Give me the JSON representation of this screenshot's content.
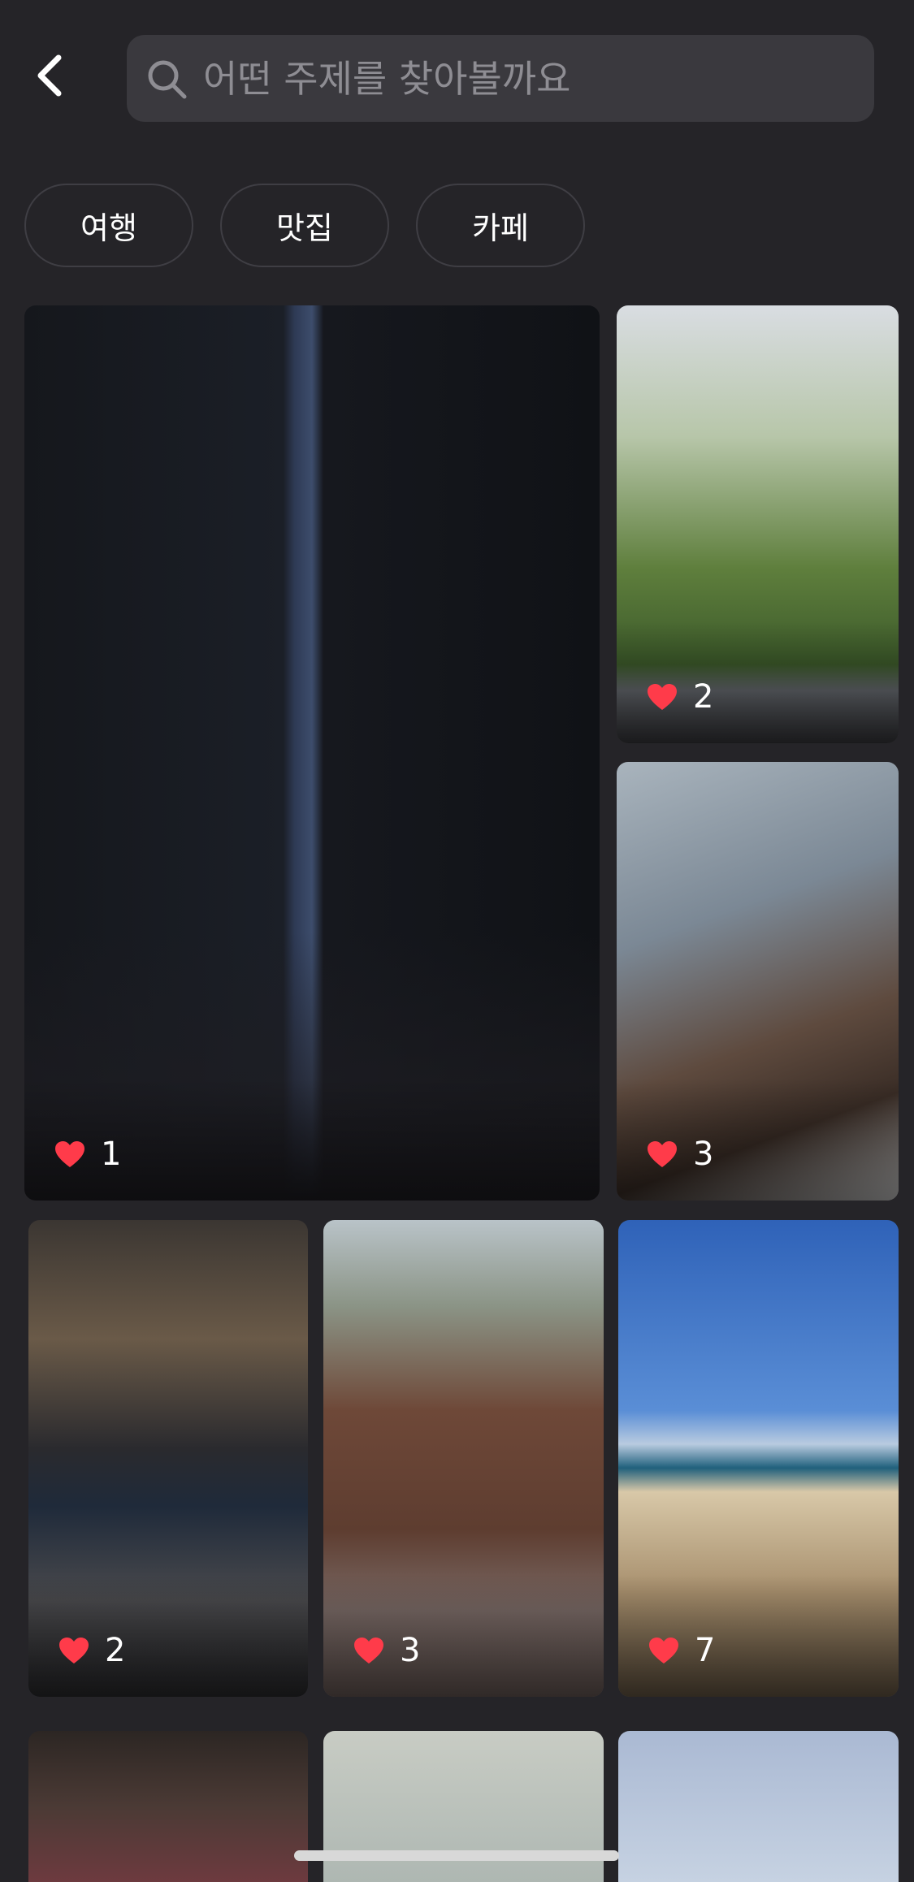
{
  "header": {
    "back_icon": "chevron-left-icon",
    "search": {
      "placeholder": "어떤 주제를 찾아볼까요",
      "value": "",
      "icon": "search-icon"
    }
  },
  "chips": [
    {
      "label": "여행"
    },
    {
      "label": "맛집"
    },
    {
      "label": "카페"
    }
  ],
  "feed": {
    "like_icon": "heart-icon",
    "like_color": "#ff3b4a",
    "posts": [
      {
        "likes": "1"
      },
      {
        "likes": "2"
      },
      {
        "likes": "3"
      },
      {
        "likes": "2"
      },
      {
        "likes": "3"
      },
      {
        "likes": "7"
      }
    ]
  },
  "colors": {
    "background": "#252428",
    "search_bg": "#3a393e",
    "chip_border": "#3f3e44"
  }
}
